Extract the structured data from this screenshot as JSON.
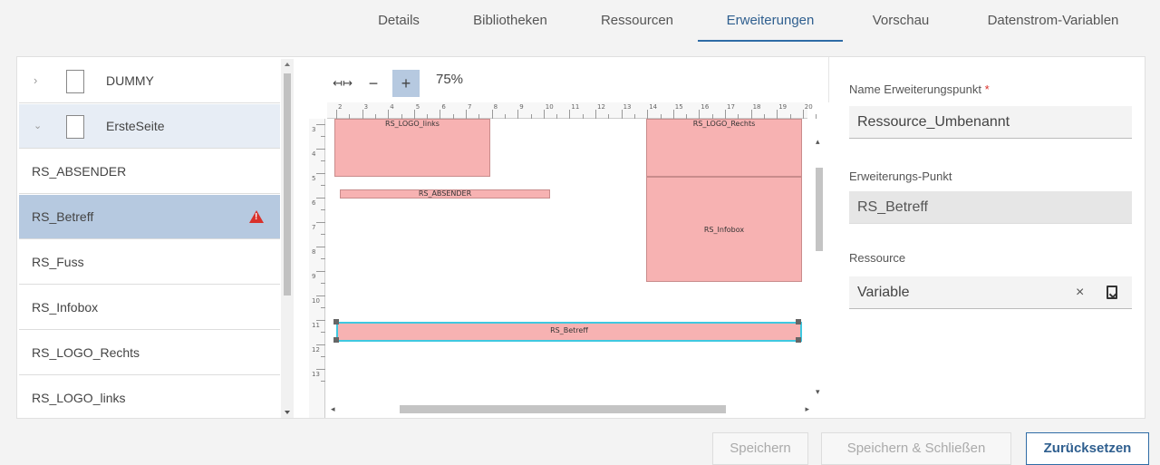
{
  "tabs": [
    {
      "label": "Details"
    },
    {
      "label": "Bibliotheken"
    },
    {
      "label": "Ressourcen"
    },
    {
      "label": "Erweiterungen",
      "active": true
    },
    {
      "label": "Vorschau"
    },
    {
      "label": "Datenstrom-Variablen"
    }
  ],
  "tree": {
    "groups": [
      {
        "label": "DUMMY",
        "icon": "chevron-right-icon"
      },
      {
        "label": "ErsteSeite",
        "icon": "chevron-down-icon"
      }
    ],
    "items": [
      {
        "label": "RS_ABSENDER"
      },
      {
        "label": "RS_Betreff",
        "selected": true,
        "status_icon": "warning-icon"
      },
      {
        "label": "RS_Fuss"
      },
      {
        "label": "RS_Infobox"
      },
      {
        "label": "RS_LOGO_Rechts"
      },
      {
        "label": "RS_LOGO_links"
      }
    ]
  },
  "designer": {
    "zoom": "75%",
    "ruler_h": [
      "2",
      "3",
      "4",
      "5",
      "6",
      "7",
      "8",
      "9",
      "10",
      "11",
      "12",
      "13",
      "14",
      "15",
      "16",
      "17",
      "18",
      "19",
      "20"
    ],
    "ruler_v": [
      "3",
      "4",
      "5",
      "6",
      "7",
      "8",
      "9",
      "10",
      "11",
      "12",
      "13"
    ],
    "boxes": {
      "logo_links": "RS_LOGO_links",
      "logo_rechts": "RS_LOGO_Rechts",
      "absender": "RS_ABSENDER",
      "infobox": "RS_Infobox",
      "betreff": "RS_Betreff"
    }
  },
  "properties": {
    "name_label": "Name Erweiterungspunkt",
    "name_required": "*",
    "name_value": "Ressource_Umbenannt",
    "point_label": "Erweiterungs-Punkt",
    "point_value": "RS_Betreff",
    "resource_label": "Ressource",
    "resource_value": "Variable",
    "clear_symbol": "×"
  },
  "buttons": {
    "save": "Speichern",
    "save_close": "Speichern & Schließen",
    "reset": "Zurücksetzen"
  },
  "colors": {
    "accent": "#2f6ca6",
    "selection": "#b6c9e0",
    "field_box": "#f7b2b2",
    "selected_outline": "#3fc8e0",
    "warning": "#d9312b"
  }
}
